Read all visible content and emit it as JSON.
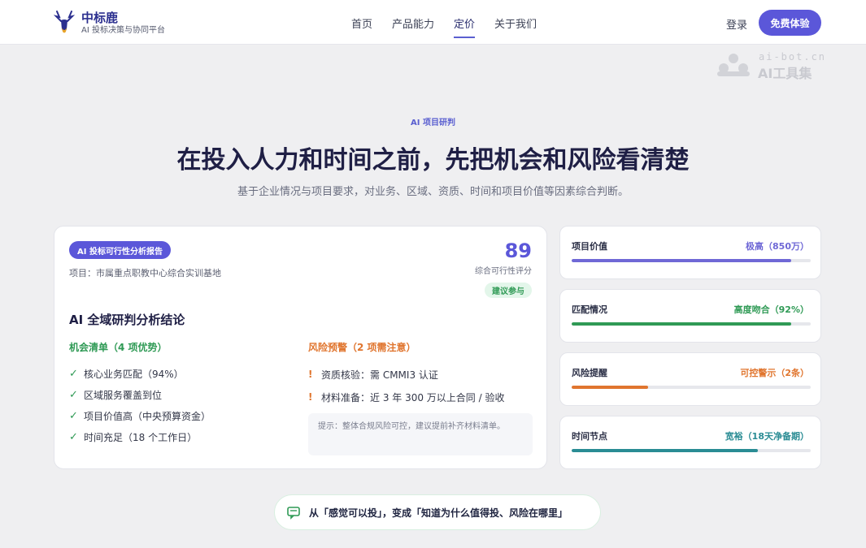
{
  "header": {
    "brand_name": "中标鹿",
    "brand_sub": "AI 投标决策与协同平台",
    "nav": [
      {
        "label": "首页",
        "active": false
      },
      {
        "label": "产品能力",
        "active": false
      },
      {
        "label": "定价",
        "active": true
      },
      {
        "label": "关于我们",
        "active": false
      }
    ],
    "login": "登录",
    "cta": "免费体验"
  },
  "watermark": {
    "line1": "ai-bot.cn",
    "line2": "AI工具集"
  },
  "hero": {
    "eyebrow": "AI 项目研判",
    "title": "在投入人力和时间之前，先把机会和风险看清楚",
    "subtitle": "基于企业情况与项目要求，对业务、区域、资质、时间和项目价值等因素综合判断。"
  },
  "report": {
    "badge": "AI 投标可行性分析报告",
    "project": "项目：市属重点职教中心综合实训基地",
    "score": "89",
    "score_label": "综合可行性评分",
    "score_chip": "建议参与",
    "heading": "AI 全域研判分析结论",
    "opportunities_title": "机会清单（4 项优势）",
    "opportunities": [
      "核心业务匹配（94%）",
      "区域服务覆盖到位",
      "项目价值高（中央预算资金）",
      "时间充足（18 个工作日）"
    ],
    "risks_title": "风险预警（2 项需注意）",
    "risks": [
      "资质核验：需 CMMI3 认证",
      "材料准备：近 3 年 300 万以上合同 / 验收"
    ],
    "tip": "提示：整体合规风险可控，建议提前补齐材料清单。"
  },
  "metrics": [
    {
      "label": "项目价值",
      "value": "极高（850万）",
      "color": "#6f68d6",
      "progress": 0.92
    },
    {
      "label": "匹配情况",
      "value": "高度吻合（92%）",
      "color": "#2f9a55",
      "progress": 0.92
    },
    {
      "label": "风险提醒",
      "value": "可控警示（2条）",
      "color": "#e0752e",
      "progress": 0.32
    },
    {
      "label": "时间节点",
      "value": "宽裕（18天净备期）",
      "color": "#2a8c94",
      "progress": 0.78
    }
  ],
  "bottom_pill": "从「感觉可以投」，变成「知道为什么值得投、风险在哪里」"
}
